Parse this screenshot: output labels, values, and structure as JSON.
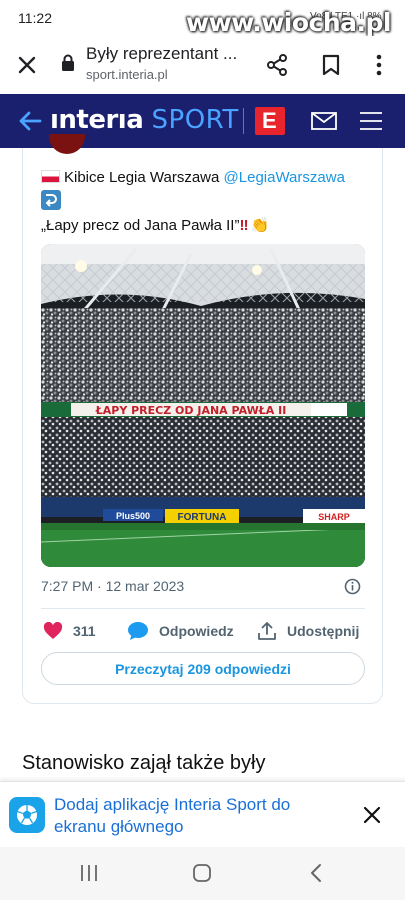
{
  "status_bar": {
    "time": "11:22",
    "indicators": "Vo8 LTE1 ·ıl 8%",
    "watermark": "www.wiocha.pl"
  },
  "browser": {
    "page_title": "Były reprezentant ...",
    "url": "sport.interia.pl",
    "icons": [
      "close-icon",
      "lock-icon",
      "share-icon",
      "bookmark-icon",
      "more-vertical-icon"
    ]
  },
  "site_header": {
    "brand": "ınterıa",
    "section": "SPORT",
    "e_logo": "E",
    "icons": [
      "back-arrow-icon",
      "mail-icon",
      "hamburger-icon"
    ],
    "colors": {
      "background": "#1a1f6e",
      "sport": "#4aa3ff",
      "e_logo": "#e8242c"
    }
  },
  "tweet": {
    "author_name": "Kibice Legia Warszawa",
    "handle": "@LegiaWarszawa",
    "return_emoji": "⤵",
    "text": "„Łapy precz od Jana Pawła II”",
    "text_emoji_exclaim": "‼",
    "text_emoji_clap": "👏",
    "photo_banner": "ŁAPY PRECZ OD JANA PAWŁA II",
    "photo_ads": [
      "Plus500",
      "FORTUNA",
      "SHARP"
    ],
    "timestamp": "7:27 PM · 12 mar 2023",
    "likes": "311",
    "reply_label": "Odpowiedz",
    "share_label": "Udostępnij",
    "read_replies": "Przeczytaj 209 odpowiedzi",
    "colors": {
      "link": "#1b95e0",
      "like": "#e0245e"
    }
  },
  "article": {
    "text": "Stanowisko zajął także były"
  },
  "app_banner": {
    "text": "Dodaj aplikację Interia Sport do ekranu głównego",
    "icons": [
      "soccer-ball-icon",
      "close-icon"
    ]
  },
  "nav_bar": {
    "icons": [
      "recent-apps-icon",
      "home-icon",
      "back-icon"
    ]
  }
}
